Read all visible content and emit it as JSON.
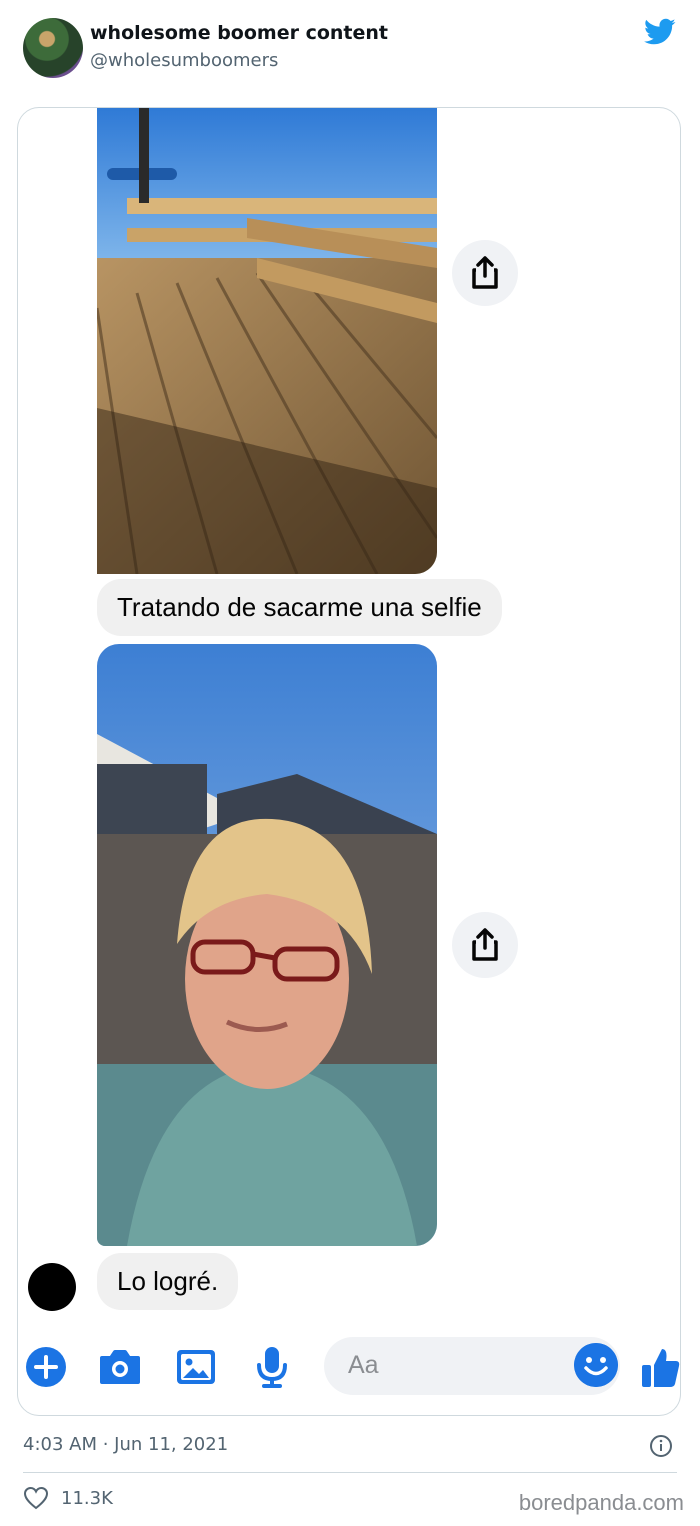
{
  "tweet": {
    "author_name": "wholesome boomer content",
    "author_handle": "@wholesumboomers",
    "timestamp": "4:03 AM · Jun 11, 2021",
    "likes": "11.3K"
  },
  "messenger": {
    "messages": [
      "Tratando de sacarme una selfie",
      "Lo logré."
    ],
    "composer_placeholder": "Aa"
  },
  "watermark": "boredpanda.com",
  "colors": {
    "twitter_blue": "#1d9bf0",
    "messenger_blue": "#1b74e4",
    "bubble_gray": "#f0f0f0"
  },
  "icons": {
    "header": "twitter-bird-icon",
    "share": "share-icon",
    "composer": [
      "plus-icon",
      "camera-icon",
      "image-icon",
      "microphone-icon",
      "emoji-icon",
      "thumbs-up-icon"
    ],
    "footer": [
      "info-icon",
      "heart-icon"
    ]
  }
}
